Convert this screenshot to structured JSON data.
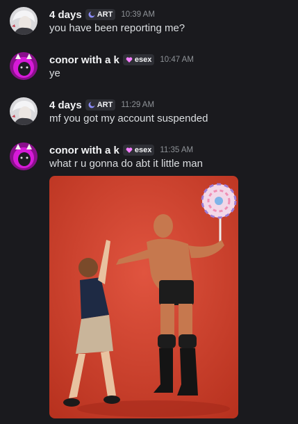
{
  "messages": [
    {
      "username": "4 days",
      "tag": "ART",
      "tag_icon": "crescent-icon",
      "time": "10:39 AM",
      "text": "you have been reporting me?"
    },
    {
      "username": "conor with a k",
      "tag": "esex",
      "tag_icon": "heart-icon",
      "time": "10:47 AM",
      "text": "ye"
    },
    {
      "username": "4 days",
      "tag": "ART",
      "tag_icon": "crescent-icon",
      "time": "11:29 AM",
      "text": "mf you got my account suspended"
    },
    {
      "username": "conor with a k",
      "tag": "esex",
      "tag_icon": "heart-icon",
      "time": "11:35 AM",
      "text": "what r u gonna do abt it little man"
    }
  ],
  "colors": {
    "background": "#1a1a1e",
    "username": "#f2f3f5",
    "timestamp": "#8e9297",
    "art_tag_icon": "#8b8cf8",
    "esex_tag_icon": "#f47fff"
  }
}
